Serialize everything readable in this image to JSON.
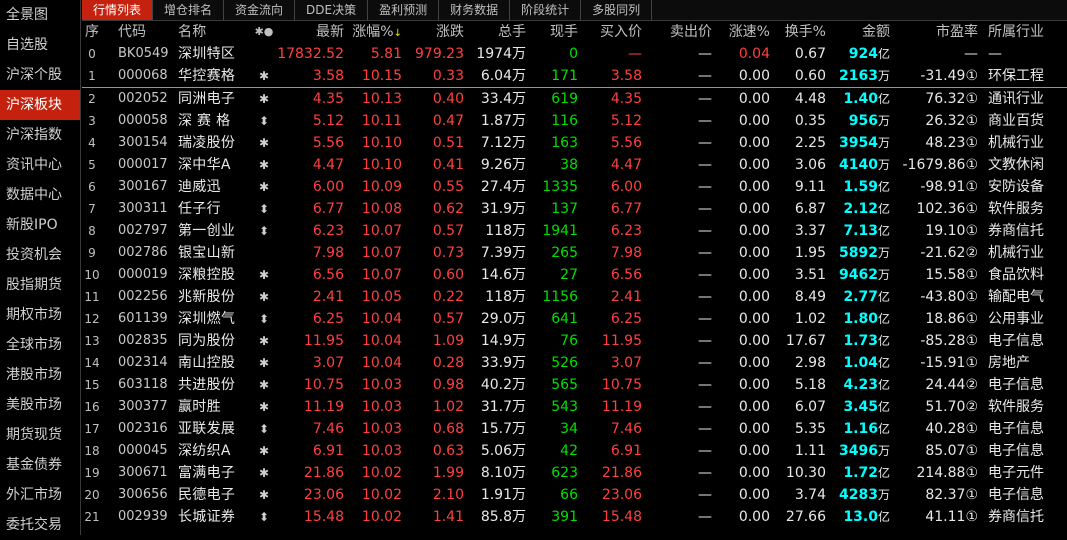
{
  "sidebar": {
    "items": [
      {
        "label": "全景图"
      },
      {
        "label": "自选股"
      },
      {
        "label": "沪深个股"
      },
      {
        "label": "沪深板块"
      },
      {
        "label": "沪深指数"
      },
      {
        "label": "资讯中心"
      },
      {
        "label": "数据中心"
      },
      {
        "label": "新股IPO"
      },
      {
        "label": "投资机会"
      },
      {
        "label": "股指期货"
      },
      {
        "label": "期权市场"
      },
      {
        "label": "全球市场"
      },
      {
        "label": "港股市场"
      },
      {
        "label": "美股市场"
      },
      {
        "label": "期货现货"
      },
      {
        "label": "基金债券"
      },
      {
        "label": "外汇市场"
      },
      {
        "label": "委托交易"
      }
    ],
    "active_index": 3
  },
  "tabs": [
    {
      "label": "行情列表"
    },
    {
      "label": "增仓排名"
    },
    {
      "label": "资金流向"
    },
    {
      "label": "DDE决策"
    },
    {
      "label": "盈利预测"
    },
    {
      "label": "财务数据"
    },
    {
      "label": "阶段统计"
    },
    {
      "label": "多股同列"
    }
  ],
  "columns": {
    "seq": "序",
    "code": "代码",
    "name": "名称",
    "flag": "✱●",
    "last": "最新",
    "pct": "涨幅%",
    "change": "涨跌",
    "volume": "总手",
    "current": "现手",
    "bid": "买入价",
    "ask": "卖出价",
    "speed": "涨速%",
    "turnover": "换手%",
    "amount": "金额",
    "pe": "市盈率",
    "industry": "所属行业"
  },
  "sort_arrow": "↓",
  "rows": [
    {
      "seq": "0",
      "code": "BK0549",
      "name": "深圳特区",
      "flag": "",
      "last": "17832.52",
      "pct": "5.81",
      "change": "979.23",
      "volume": "1974万",
      "current": "0",
      "bid": "—",
      "ask": "—",
      "speed": "0.04",
      "speed_color": "red",
      "turnover": "0.67",
      "amount": "924亿",
      "pe": "—",
      "industry": "—"
    },
    {
      "seq": "1",
      "code": "000068",
      "name": "华控赛格",
      "flag": "✱",
      "last": "3.58",
      "pct": "10.15",
      "change": "0.33",
      "volume": "6.04万",
      "current": "171",
      "bid": "3.58",
      "ask": "—",
      "speed": "0.00",
      "speed_color": "white",
      "turnover": "0.60",
      "amount": "2163万",
      "pe": "-31.49①",
      "industry": "环保工程"
    },
    {
      "seq": "2",
      "code": "002052",
      "name": "同洲电子",
      "flag": "✱",
      "last": "4.35",
      "pct": "10.13",
      "change": "0.40",
      "volume": "33.4万",
      "current": "619",
      "bid": "4.35",
      "ask": "—",
      "speed": "0.00",
      "speed_color": "white",
      "turnover": "4.48",
      "amount": "1.40亿",
      "pe": "76.32①",
      "industry": "通讯行业"
    },
    {
      "seq": "3",
      "code": "000058",
      "name": "深 赛 格",
      "flag": "⬍",
      "last": "5.12",
      "pct": "10.11",
      "change": "0.47",
      "volume": "1.87万",
      "current": "116",
      "bid": "5.12",
      "ask": "—",
      "speed": "0.00",
      "speed_color": "white",
      "turnover": "0.35",
      "amount": "956万",
      "pe": "26.32①",
      "industry": "商业百货"
    },
    {
      "seq": "4",
      "code": "300154",
      "name": "瑞凌股份",
      "flag": "✱",
      "last": "5.56",
      "pct": "10.10",
      "change": "0.51",
      "volume": "7.12万",
      "current": "163",
      "bid": "5.56",
      "ask": "—",
      "speed": "0.00",
      "speed_color": "white",
      "turnover": "2.25",
      "amount": "3954万",
      "pe": "48.23①",
      "industry": "机械行业"
    },
    {
      "seq": "5",
      "code": "000017",
      "name": "深中华A",
      "flag": "✱",
      "last": "4.47",
      "pct": "10.10",
      "change": "0.41",
      "volume": "9.26万",
      "current": "38",
      "bid": "4.47",
      "ask": "—",
      "speed": "0.00",
      "speed_color": "white",
      "turnover": "3.06",
      "amount": "4140万",
      "pe": "-1679.86①",
      "industry": "文教休闲"
    },
    {
      "seq": "6",
      "code": "300167",
      "name": "迪威迅",
      "flag": "✱",
      "last": "6.00",
      "pct": "10.09",
      "change": "0.55",
      "volume": "27.4万",
      "current": "1335",
      "bid": "6.00",
      "ask": "—",
      "speed": "0.00",
      "speed_color": "white",
      "turnover": "9.11",
      "amount": "1.59亿",
      "pe": "-98.91①",
      "industry": "安防设备"
    },
    {
      "seq": "7",
      "code": "300311",
      "name": "任子行",
      "flag": "⬍",
      "last": "6.77",
      "pct": "10.08",
      "change": "0.62",
      "volume": "31.9万",
      "current": "137",
      "bid": "6.77",
      "ask": "—",
      "speed": "0.00",
      "speed_color": "white",
      "turnover": "6.87",
      "amount": "2.12亿",
      "pe": "102.36①",
      "industry": "软件服务"
    },
    {
      "seq": "8",
      "code": "002797",
      "name": "第一创业",
      "flag": "⬍",
      "last": "6.23",
      "pct": "10.07",
      "change": "0.57",
      "volume": "118万",
      "current": "1941",
      "bid": "6.23",
      "ask": "—",
      "speed": "0.00",
      "speed_color": "white",
      "turnover": "3.37",
      "amount": "7.13亿",
      "pe": "19.10①",
      "industry": "券商信托"
    },
    {
      "seq": "9",
      "code": "002786",
      "name": "银宝山新",
      "flag": "",
      "last": "7.98",
      "pct": "10.07",
      "change": "0.73",
      "volume": "7.39万",
      "current": "265",
      "bid": "7.98",
      "ask": "—",
      "speed": "0.00",
      "speed_color": "white",
      "turnover": "1.95",
      "amount": "5892万",
      "pe": "-21.62②",
      "industry": "机械行业"
    },
    {
      "seq": "10",
      "code": "000019",
      "name": "深粮控股",
      "flag": "✱",
      "last": "6.56",
      "pct": "10.07",
      "change": "0.60",
      "volume": "14.6万",
      "current": "27",
      "bid": "6.56",
      "ask": "—",
      "speed": "0.00",
      "speed_color": "white",
      "turnover": "3.51",
      "amount": "9462万",
      "pe": "15.58①",
      "industry": "食品饮料"
    },
    {
      "seq": "11",
      "code": "002256",
      "name": "兆新股份",
      "flag": "✱",
      "last": "2.41",
      "pct": "10.05",
      "change": "0.22",
      "volume": "118万",
      "current": "1156",
      "bid": "2.41",
      "ask": "—",
      "speed": "0.00",
      "speed_color": "white",
      "turnover": "8.49",
      "amount": "2.77亿",
      "pe": "-43.80①",
      "industry": "输配电气"
    },
    {
      "seq": "12",
      "code": "601139",
      "name": "深圳燃气",
      "flag": "⬍",
      "last": "6.25",
      "pct": "10.04",
      "change": "0.57",
      "volume": "29.0万",
      "current": "641",
      "bid": "6.25",
      "ask": "—",
      "speed": "0.00",
      "speed_color": "white",
      "turnover": "1.02",
      "amount": "1.80亿",
      "pe": "18.86①",
      "industry": "公用事业"
    },
    {
      "seq": "13",
      "code": "002835",
      "name": "同为股份",
      "flag": "✱",
      "last": "11.95",
      "pct": "10.04",
      "change": "1.09",
      "volume": "14.9万",
      "current": "76",
      "bid": "11.95",
      "ask": "—",
      "speed": "0.00",
      "speed_color": "white",
      "turnover": "17.67",
      "amount": "1.73亿",
      "pe": "-85.28①",
      "industry": "电子信息"
    },
    {
      "seq": "14",
      "code": "002314",
      "name": "南山控股",
      "flag": "✱",
      "last": "3.07",
      "pct": "10.04",
      "change": "0.28",
      "volume": "33.9万",
      "current": "526",
      "bid": "3.07",
      "ask": "—",
      "speed": "0.00",
      "speed_color": "white",
      "turnover": "2.98",
      "amount": "1.04亿",
      "pe": "-15.91①",
      "industry": "房地产"
    },
    {
      "seq": "15",
      "code": "603118",
      "name": "共进股份",
      "flag": "✱",
      "last": "10.75",
      "pct": "10.03",
      "change": "0.98",
      "volume": "40.2万",
      "current": "565",
      "bid": "10.75",
      "ask": "—",
      "speed": "0.00",
      "speed_color": "white",
      "turnover": "5.18",
      "amount": "4.23亿",
      "pe": "24.44②",
      "industry": "电子信息"
    },
    {
      "seq": "16",
      "code": "300377",
      "name": "赢时胜",
      "flag": "✱",
      "last": "11.19",
      "pct": "10.03",
      "change": "1.02",
      "volume": "31.7万",
      "current": "543",
      "bid": "11.19",
      "ask": "—",
      "speed": "0.00",
      "speed_color": "white",
      "turnover": "6.07",
      "amount": "3.45亿",
      "pe": "51.70②",
      "industry": "软件服务"
    },
    {
      "seq": "17",
      "code": "002316",
      "name": "亚联发展",
      "flag": "⬍",
      "last": "7.46",
      "pct": "10.03",
      "change": "0.68",
      "volume": "15.7万",
      "current": "34",
      "bid": "7.46",
      "ask": "—",
      "speed": "0.00",
      "speed_color": "white",
      "turnover": "5.35",
      "amount": "1.16亿",
      "pe": "40.28①",
      "industry": "电子信息"
    },
    {
      "seq": "18",
      "code": "000045",
      "name": "深纺织A",
      "flag": "✱",
      "last": "6.91",
      "pct": "10.03",
      "change": "0.63",
      "volume": "5.06万",
      "current": "42",
      "bid": "6.91",
      "ask": "—",
      "speed": "0.00",
      "speed_color": "white",
      "turnover": "1.11",
      "amount": "3496万",
      "pe": "85.07①",
      "industry": "电子信息"
    },
    {
      "seq": "19",
      "code": "300671",
      "name": "富满电子",
      "flag": "✱",
      "last": "21.86",
      "pct": "10.02",
      "change": "1.99",
      "volume": "8.10万",
      "current": "623",
      "bid": "21.86",
      "ask": "—",
      "speed": "0.00",
      "speed_color": "white",
      "turnover": "10.30",
      "amount": "1.72亿",
      "pe": "214.88①",
      "industry": "电子元件"
    },
    {
      "seq": "20",
      "code": "300656",
      "name": "民德电子",
      "flag": "✱",
      "last": "23.06",
      "pct": "10.02",
      "change": "2.10",
      "volume": "1.91万",
      "current": "66",
      "bid": "23.06",
      "ask": "—",
      "speed": "0.00",
      "speed_color": "white",
      "turnover": "3.74",
      "amount": "4283万",
      "pe": "82.37①",
      "industry": "电子信息"
    },
    {
      "seq": "21",
      "code": "002939",
      "name": "长城证券",
      "flag": "⬍",
      "last": "15.48",
      "pct": "10.02",
      "change": "1.41",
      "volume": "85.8万",
      "current": "391",
      "bid": "15.48",
      "ask": "—",
      "speed": "0.00",
      "speed_color": "white",
      "turnover": "27.66",
      "amount": "13.0亿",
      "pe": "41.11①",
      "industry": "券商信托"
    }
  ],
  "colors": {
    "up": "#ff4040",
    "vol_green": "#00e000",
    "amount": "#00ffff",
    "active_tab": "#c4220e",
    "separator": "#b8a000"
  }
}
